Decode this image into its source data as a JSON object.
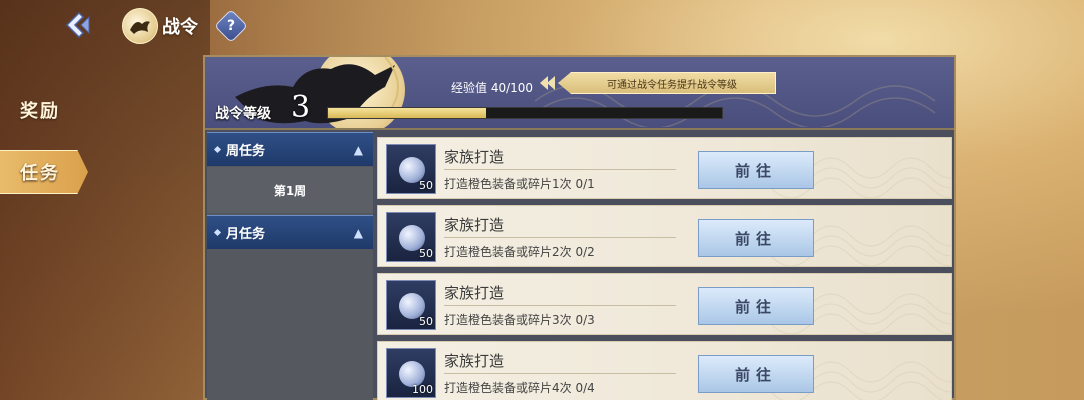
{
  "header": {
    "title": "战令",
    "help_label": "?"
  },
  "nav": {
    "items": [
      {
        "label": "奖励",
        "active": false
      },
      {
        "label": "任务",
        "active": true
      }
    ]
  },
  "battle_pass": {
    "level_label": "战令等级",
    "level": "3",
    "exp_text": "经验值 40/100",
    "exp_current": 40,
    "exp_max": 100,
    "hint": "可通过战令任务提升战令等级"
  },
  "categories": [
    {
      "label": "周任务",
      "sub": "第1周"
    },
    {
      "label": "月任务"
    }
  ],
  "tasks": [
    {
      "name": "家族打造",
      "desc": "打造橙色装备或碎片1次  0/1",
      "qty": "50",
      "button": "前往"
    },
    {
      "name": "家族打造",
      "desc": "打造橙色装备或碎片2次  0/2",
      "qty": "50",
      "button": "前往"
    },
    {
      "name": "家族打造",
      "desc": "打造橙色装备或碎片3次  0/3",
      "qty": "50",
      "button": "前往"
    },
    {
      "name": "家族打造",
      "desc": "打造橙色装备或碎片4次  0/4",
      "qty": "100",
      "button": "前往"
    }
  ],
  "colors": {
    "accent_blue": "#1f3a6a",
    "exp_fill": "#d9b957",
    "panel_header": "#4a4e7c"
  }
}
